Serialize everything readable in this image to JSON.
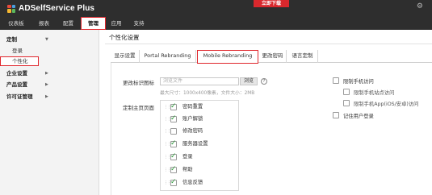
{
  "brand": {
    "name": "ADSelfService Plus",
    "logo_colors": [
      "#e84a3c",
      "#4a9fe0",
      "#f5b731",
      "#5cb85c"
    ]
  },
  "header": {
    "download_label": "立即下载",
    "settings_icon": "gear-icon"
  },
  "nav": {
    "tabs": [
      {
        "label": "仪表板"
      },
      {
        "label": "报表"
      },
      {
        "label": "配置"
      },
      {
        "label": "管理",
        "active": true
      },
      {
        "label": "应用"
      },
      {
        "label": "支持"
      }
    ]
  },
  "sidebar": {
    "items": [
      {
        "label": "定制",
        "type": "section",
        "expanded": true
      },
      {
        "label": "登录",
        "type": "sub"
      },
      {
        "label": "个性化",
        "type": "sub",
        "selected": true
      },
      {
        "label": "企业设置",
        "type": "section"
      },
      {
        "label": "产品设置",
        "type": "section"
      },
      {
        "label": "许可证管理",
        "type": "section"
      }
    ]
  },
  "page": {
    "title": "个性化设置"
  },
  "tabs": [
    {
      "label": "显示设置"
    },
    {
      "label": "Portal Rebranding"
    },
    {
      "label": "Mobile Rebranding",
      "active": true
    },
    {
      "label": "更改密码"
    },
    {
      "label": "语言定制"
    }
  ],
  "form": {
    "icon_label": "更改标识图标",
    "file_placeholder": "浏览文件",
    "browse_label": "浏览",
    "help_icon": "help-icon",
    "hint": "最大尺寸：1000x400像素，文件大小：2MB",
    "home_label": "定制主页页面",
    "options": [
      {
        "label": "密码重置",
        "checked": true
      },
      {
        "label": "账户解锁",
        "checked": true
      },
      {
        "label": "修改密码",
        "checked": false
      },
      {
        "label": "服务器设置",
        "checked": true
      },
      {
        "label": "登录",
        "checked": true
      },
      {
        "label": "帮助",
        "checked": true
      },
      {
        "label": "信息反馈",
        "checked": true
      }
    ],
    "right": {
      "restrict_mobile": {
        "label": "限制手机访问",
        "checked": false
      },
      "restrict_mobile_web": {
        "label": "限制手机站点访问",
        "checked": false
      },
      "restrict_mobile_app": {
        "label": "限制手机App(iOS/安卓)访问",
        "checked": false
      },
      "remember_login": {
        "label": "记住用户登录",
        "checked": false
      }
    }
  }
}
